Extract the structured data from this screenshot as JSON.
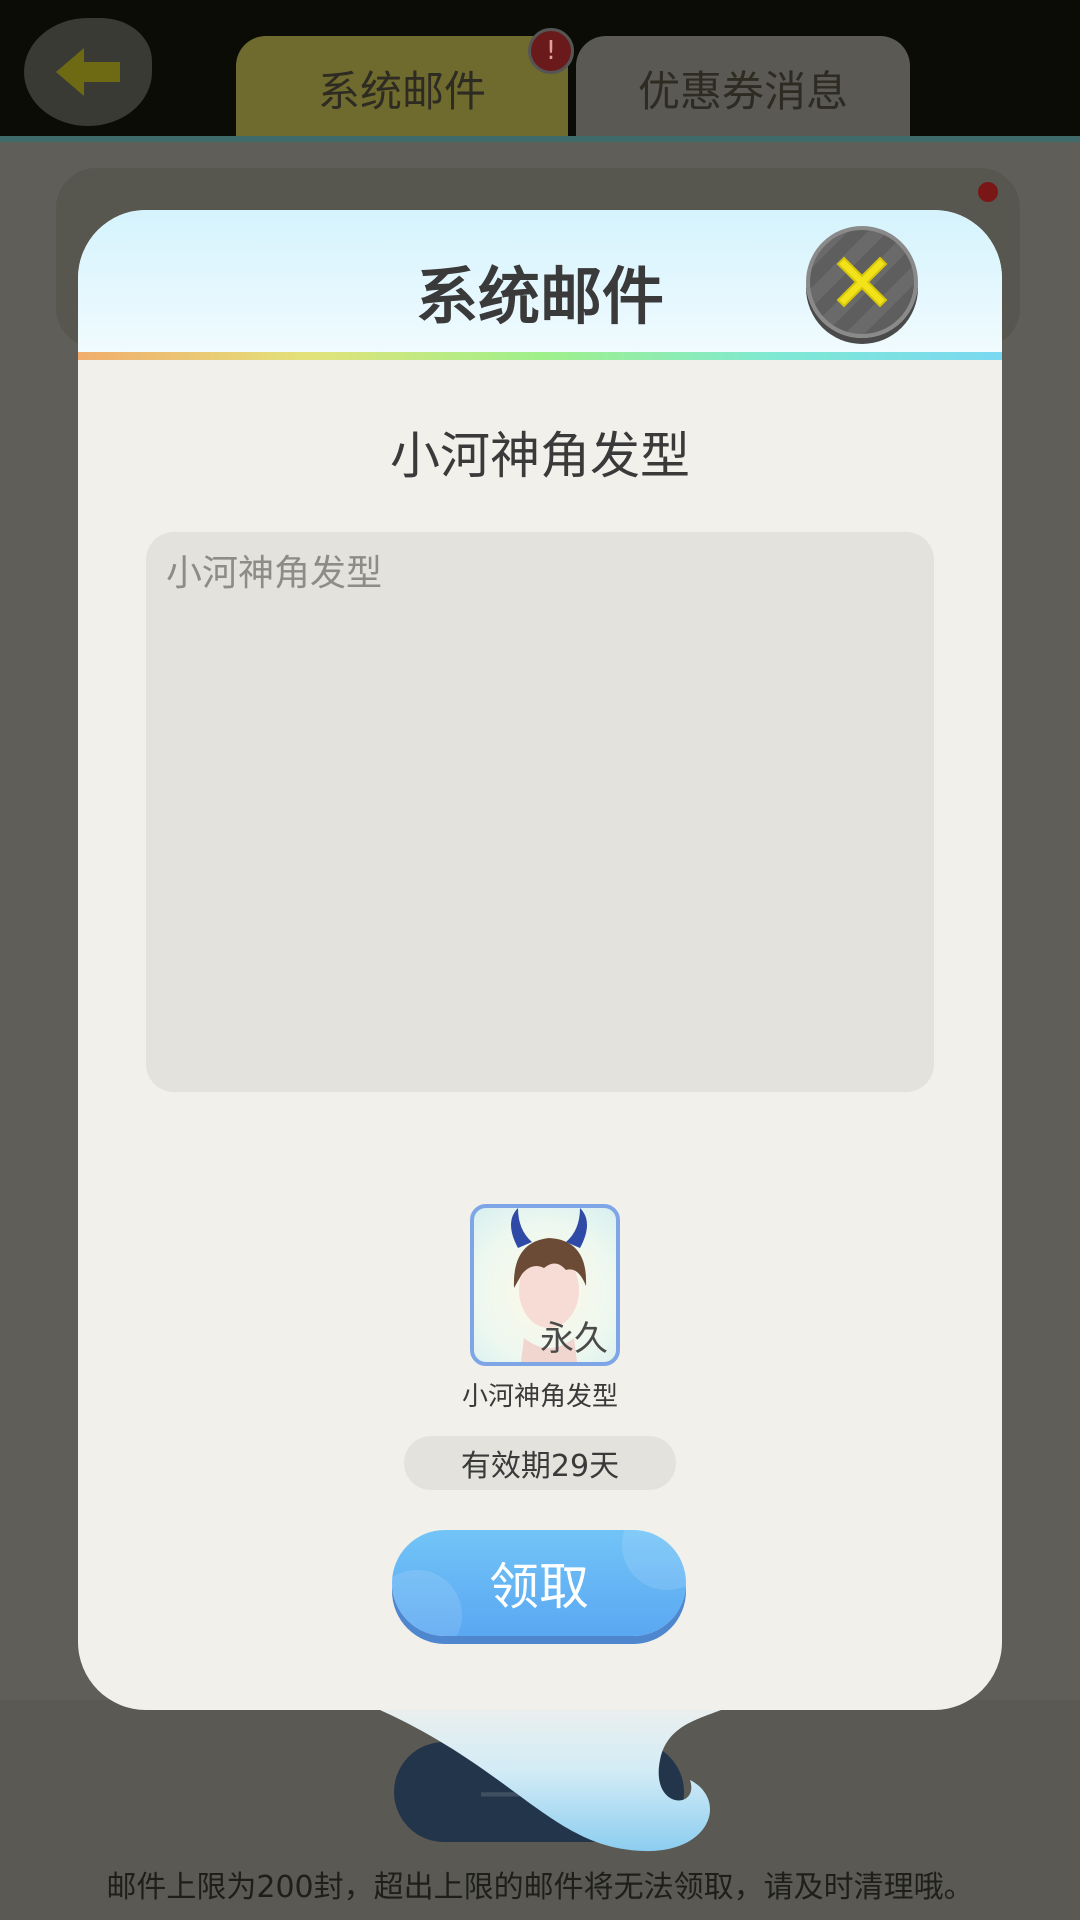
{
  "header": {
    "tabs": [
      {
        "label": "系统邮件",
        "badge": "!"
      },
      {
        "label": "优惠券消息"
      }
    ]
  },
  "background": {
    "claim_all_label": "一 取",
    "footer_note": "邮件上限为200封，超出上限的邮件将无法领取，请及时清理哦。"
  },
  "modal": {
    "title": "系统邮件",
    "subject": "小河神角发型",
    "body": "小河神角发型",
    "item": {
      "name": "小河神角发型",
      "tag": "永久",
      "icon": "dragon-horn-hairstyle-icon"
    },
    "validity": "有效期29天",
    "claim_label": "领取"
  },
  "colors": {
    "modal_bg": "#f1f0eb",
    "claim_button": "#5aa7f2",
    "close_x": "#f2e21a"
  }
}
